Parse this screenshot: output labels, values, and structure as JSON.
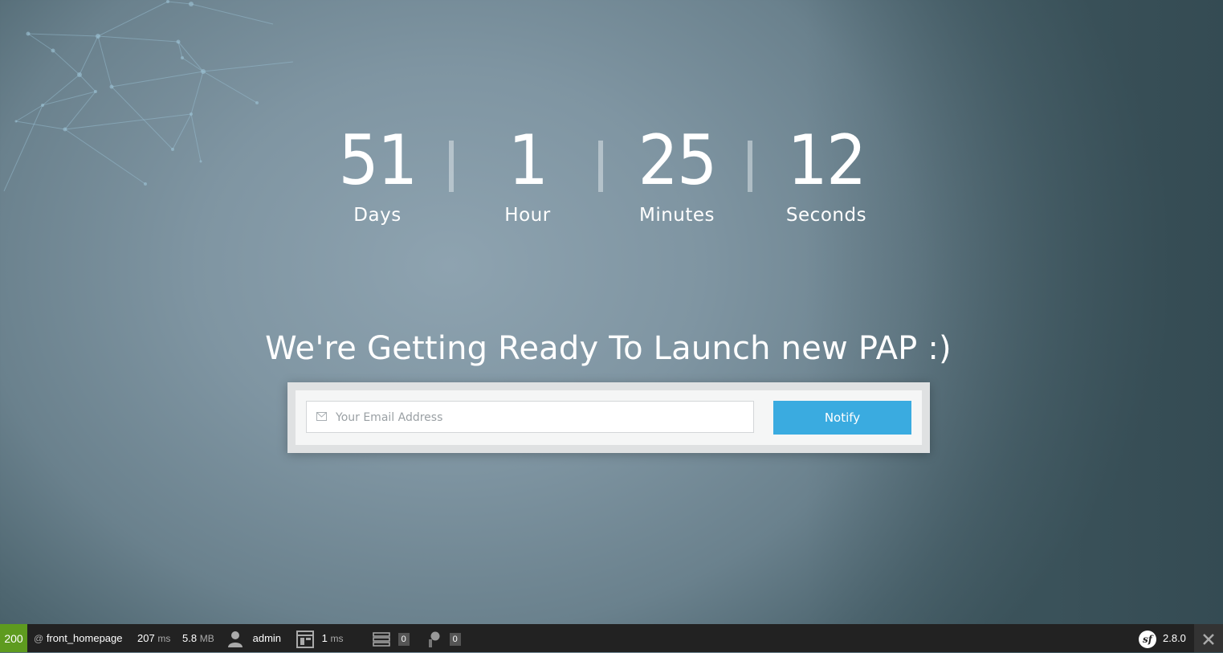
{
  "countdown": {
    "days": {
      "value": "51",
      "label": "Days"
    },
    "hours": {
      "value": "1",
      "label": "Hour"
    },
    "minutes": {
      "value": "25",
      "label": "Minutes"
    },
    "seconds": {
      "value": "12",
      "label": "Seconds"
    }
  },
  "headline": "We're Getting Ready To Launch new PAP :)",
  "form": {
    "email_placeholder": "Your Email Address",
    "email_value": "",
    "notify_label": "Notify"
  },
  "debug_toolbar": {
    "status_code": "200",
    "route_prefix": "@",
    "route": "front_homepage",
    "time_value": "207",
    "time_unit": "ms",
    "memory_value": "5.8",
    "memory_unit": "MB",
    "user": "admin",
    "render_value": "1",
    "render_unit": "ms",
    "db_queries": "0",
    "security_count": "0",
    "framework_version": "2.8.0",
    "framework_logo": "sf"
  },
  "colors": {
    "accent": "#3aabe0",
    "status_ok": "#5e9b1f",
    "toolbar_bg": "#222222"
  },
  "icons": [
    "envelope-icon",
    "user-icon",
    "layout-icon",
    "database-icon",
    "security-icon",
    "symfony-logo-icon",
    "close-icon"
  ]
}
